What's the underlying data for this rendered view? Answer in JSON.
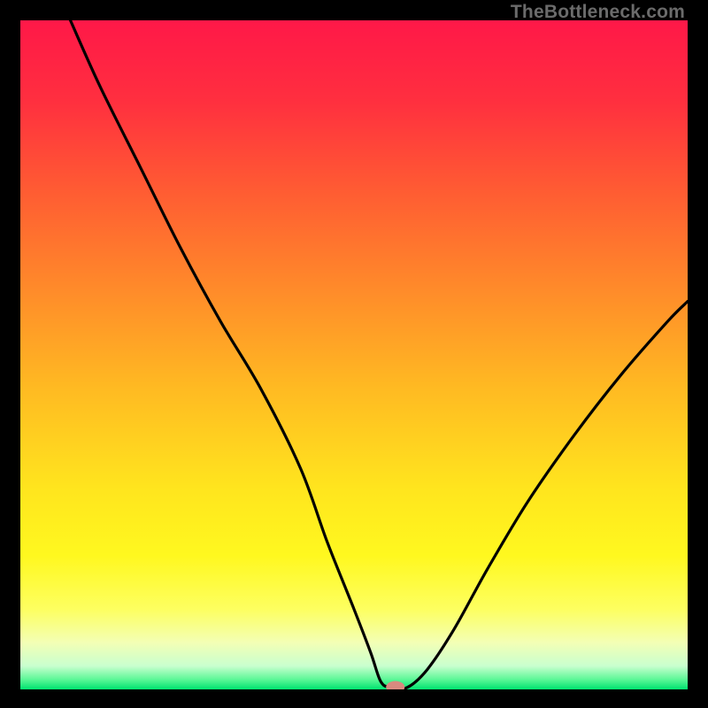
{
  "watermark": "TheBottleneck.com",
  "chart_data": {
    "type": "line",
    "title": "",
    "xlabel": "",
    "ylabel": "",
    "xlim": [
      0,
      100
    ],
    "ylim": [
      0,
      100
    ],
    "grid": false,
    "legend": false,
    "gradient_stops": [
      {
        "offset": 0.0,
        "color": "#ff1848"
      },
      {
        "offset": 0.12,
        "color": "#ff2f3f"
      },
      {
        "offset": 0.25,
        "color": "#ff5a33"
      },
      {
        "offset": 0.4,
        "color": "#ff8a2a"
      },
      {
        "offset": 0.55,
        "color": "#ffba22"
      },
      {
        "offset": 0.7,
        "color": "#ffe51e"
      },
      {
        "offset": 0.8,
        "color": "#fff81f"
      },
      {
        "offset": 0.88,
        "color": "#fdff60"
      },
      {
        "offset": 0.93,
        "color": "#f3ffb5"
      },
      {
        "offset": 0.965,
        "color": "#c9ffcf"
      },
      {
        "offset": 0.985,
        "color": "#5cf797"
      },
      {
        "offset": 1.0,
        "color": "#00e36f"
      }
    ],
    "series": [
      {
        "name": "bottleneck-curve",
        "color": "#000000",
        "x": [
          7.5,
          12,
          18,
          24,
          30,
          36,
          42,
          46,
          50,
          52.5,
          54,
          55.5,
          58,
          61,
          65,
          70,
          76,
          83,
          90,
          97,
          100
        ],
        "y": [
          100,
          90,
          78,
          66,
          55,
          45,
          33,
          22,
          12,
          5.5,
          1.2,
          0.3,
          0.3,
          3,
          9,
          18,
          28,
          38,
          47,
          55,
          58
        ]
      }
    ],
    "marker": {
      "name": "min-point",
      "x": 56.2,
      "y": 0.35,
      "rx": 1.4,
      "ry": 0.9,
      "fill": "#d88a7f"
    }
  }
}
